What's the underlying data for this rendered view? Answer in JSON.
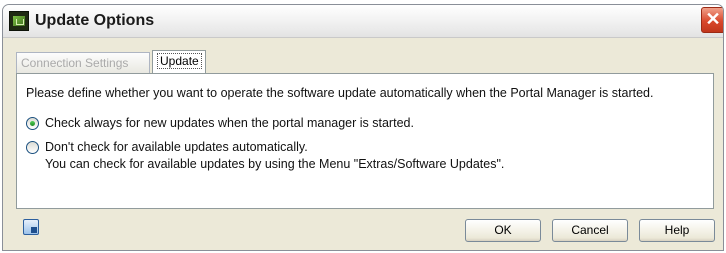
{
  "window": {
    "title": "Update Options",
    "close_icon": "close-icon",
    "close_glyph": "✕",
    "app_icon": "app-icon"
  },
  "tabs": [
    {
      "label": "Connection Settings",
      "active": false
    },
    {
      "label": "Update",
      "active": true
    }
  ],
  "panel": {
    "description": "Please define whether you want to operate the software update automatically when the Portal Manager is started.",
    "options": [
      {
        "label": "Check always for new updates when the portal manager is started.",
        "checked": true
      },
      {
        "label": "Don't check for available updates automatically.",
        "sub_label": "You can check for available updates by using the Menu \"Extras/Software Updates\".",
        "checked": false
      }
    ]
  },
  "footer": {
    "icon": "help-context-icon",
    "ok_label": "OK",
    "cancel_label": "Cancel",
    "help_label": "Help"
  },
  "colors": {
    "dialog_bg": "#ece9d8",
    "close_button": "#d9482c",
    "radio_checked": "#1e8a23"
  }
}
